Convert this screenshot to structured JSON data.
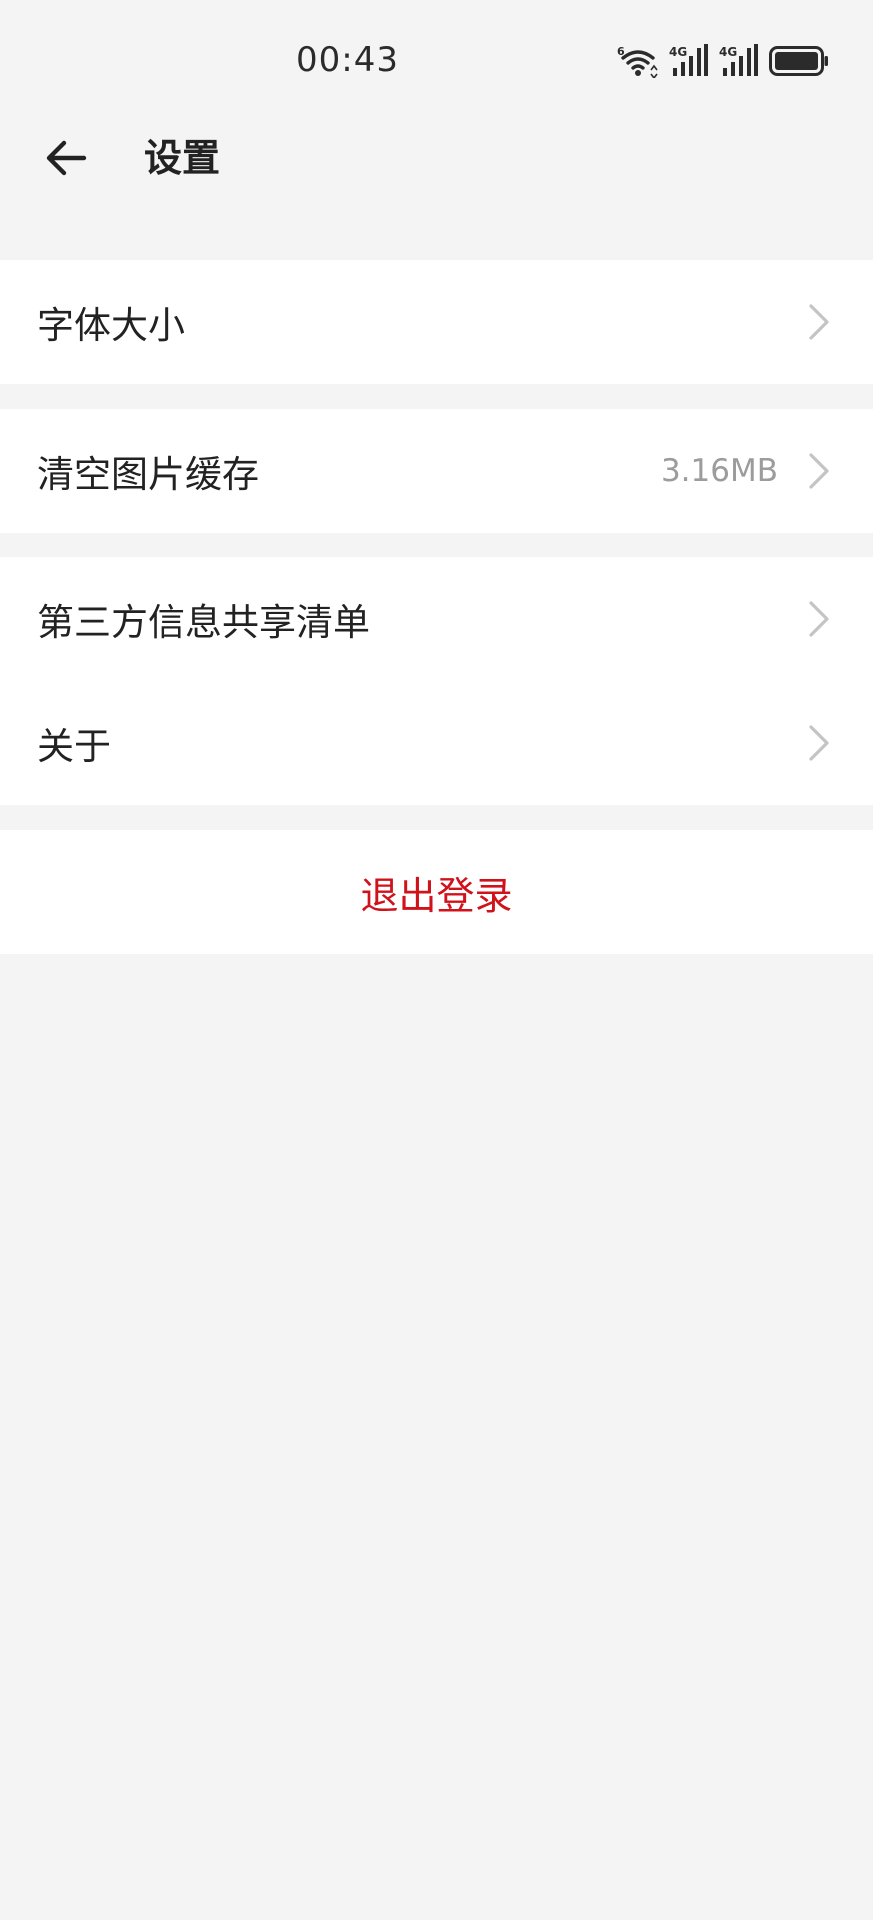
{
  "status_bar": {
    "time": "00:43",
    "icons": [
      "wifi-6-icon",
      "signal-4g-icon",
      "signal-4g-icon",
      "battery-icon"
    ],
    "wifi_badge": "6",
    "sim1_label": "4G",
    "sim2_label": "4G"
  },
  "header": {
    "back_icon": "arrow-left-icon",
    "title": "设置"
  },
  "settings": {
    "font_size": {
      "label": "字体大小"
    },
    "clear_cache": {
      "label": "清空图片缓存",
      "value": "3.16MB"
    },
    "third_party": {
      "label": "第三方信息共享清单"
    },
    "about": {
      "label": "关于"
    },
    "logout": {
      "label": "退出登录"
    }
  },
  "colors": {
    "background": "#f4f4f4",
    "card": "#ffffff",
    "text": "#222222",
    "secondary_text": "#9c9c9c",
    "danger": "#d0121b",
    "chevron": "#c4c4c4"
  }
}
